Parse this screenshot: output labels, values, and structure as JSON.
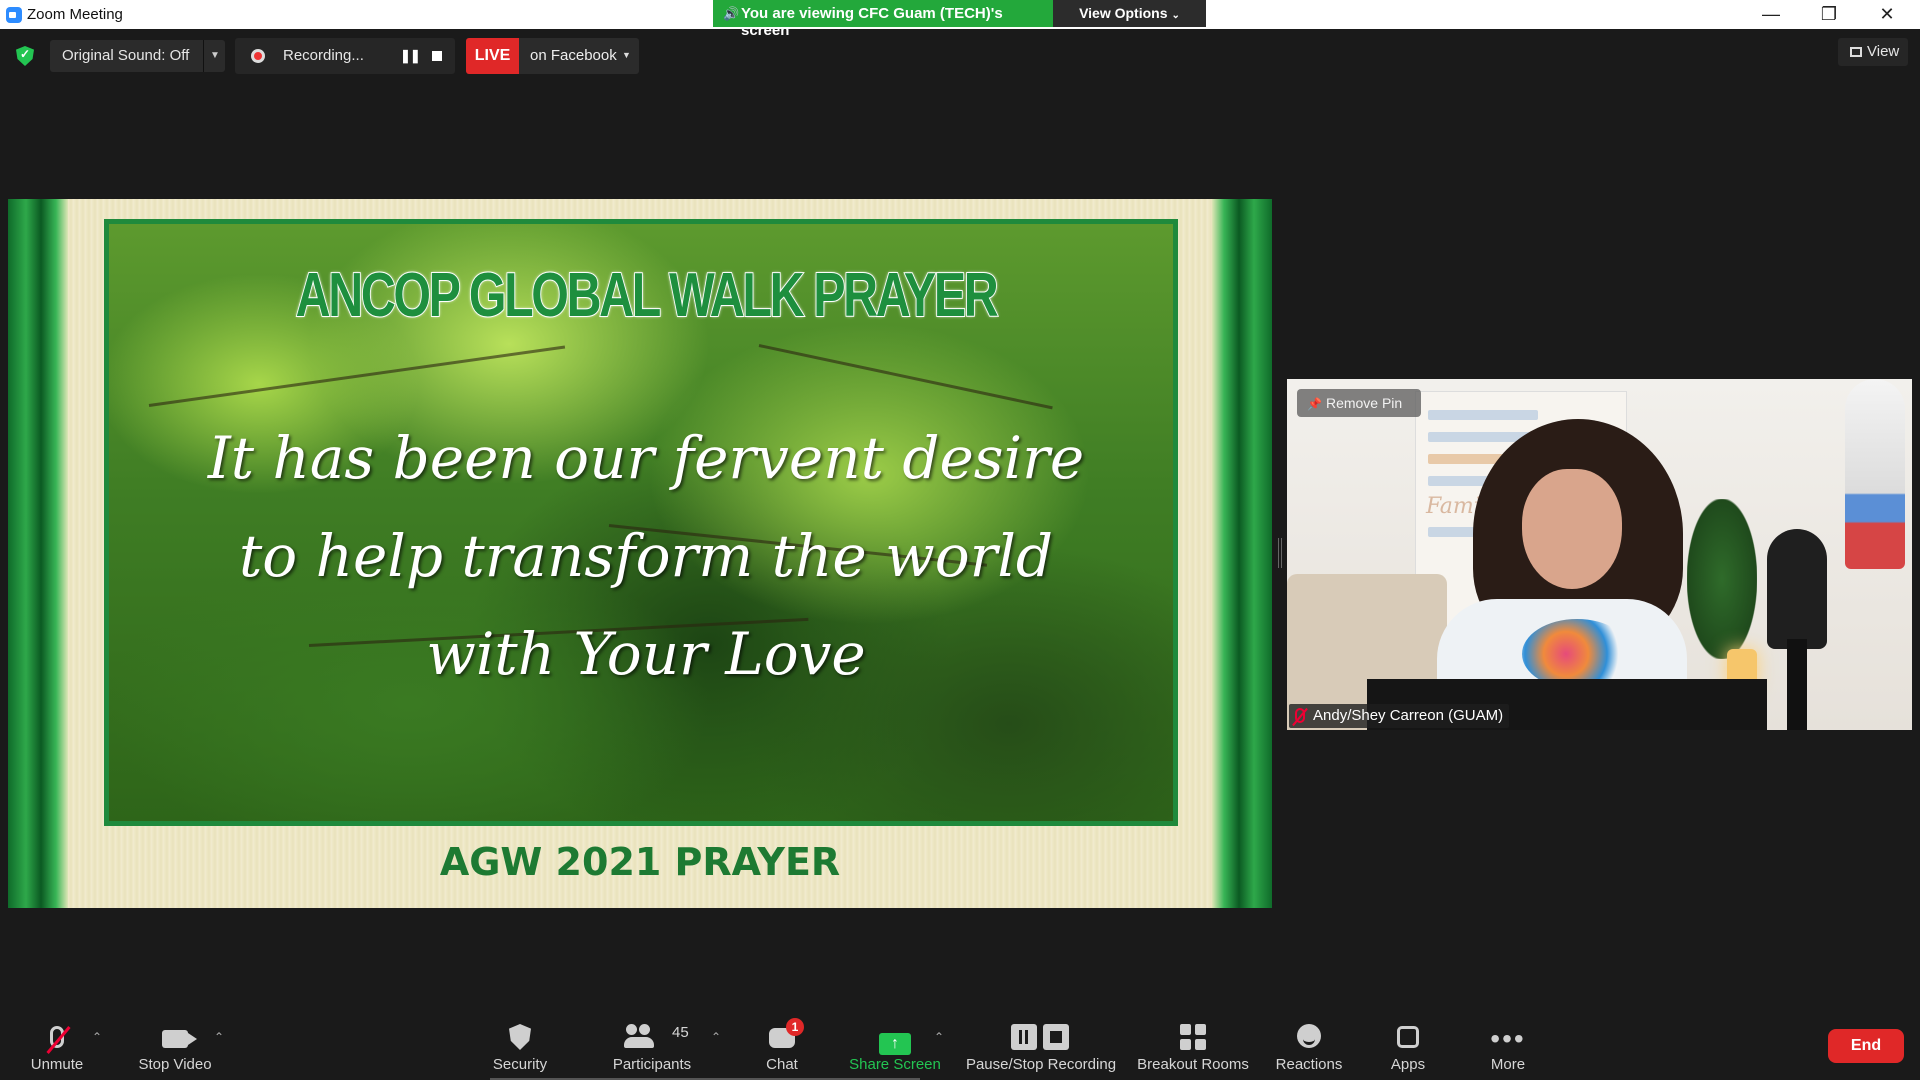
{
  "window": {
    "title": "Zoom Meeting",
    "banner_text": "You are viewing CFC Guam (TECH)'s screen",
    "view_options": "View Options"
  },
  "top_toolbar": {
    "original_sound": "Original Sound: Off",
    "recording_label": "Recording...",
    "live_badge": "LIVE",
    "live_destination": "on Facebook",
    "view_label": "View"
  },
  "shared_screen": {
    "heading": "ANCOP GLOBAL WALK PRAYER",
    "verse_lines": [
      "It has been our fervent desire",
      "to help transform the world",
      "with Your Love"
    ],
    "footer": "AGW 2021 PRAYER"
  },
  "pinned_video": {
    "remove_pin": "Remove Pin",
    "participant_name": "Andy/Shey Carreon (GUAM)",
    "board_text": "Family Ru"
  },
  "bottom_toolbar": {
    "unmute": "Unmute",
    "stop_video": "Stop Video",
    "security": "Security",
    "participants": "Participants",
    "participants_count": "45",
    "chat": "Chat",
    "chat_badge": "1",
    "share_screen": "Share Screen",
    "pause_stop_recording": "Pause/Stop Recording",
    "breakout_rooms": "Breakout Rooms",
    "reactions": "Reactions",
    "apps": "Apps",
    "more": "More",
    "end": "End"
  },
  "colors": {
    "accent_green": "#23c552",
    "end_red": "#e02828",
    "banner_green": "#23a83b"
  }
}
